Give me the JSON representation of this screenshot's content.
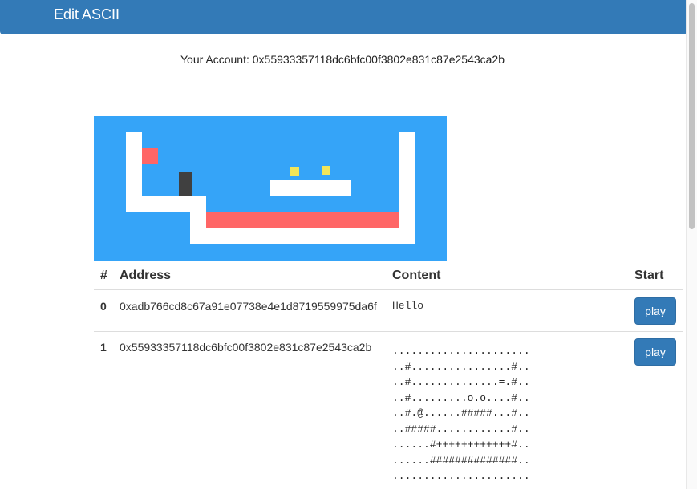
{
  "navbar": {
    "brand": "Edit ASCII"
  },
  "account": {
    "text": "Your Account: 0x55933357118dc6bfc00f3802e831c87e2543ca2b"
  },
  "table": {
    "headers": [
      "#",
      "Address",
      "Content",
      "Start"
    ],
    "rows": [
      {
        "index": "0",
        "address": "0xadb766cd8c67a91e07738e4e1d8719559975da6f",
        "content": "Hello",
        "button": "play"
      },
      {
        "index": "1",
        "address": "0x55933357118dc6bfc00f3802e831c87e2543ca2b",
        "content": "......................\n..#................#..\n..#..............=.#..\n..#.........o.o....#..\n..#.@......#####...#..\n..#####............#..\n......#++++++++++++#..\n......##############..\n......................",
        "button": "play"
      }
    ]
  },
  "colors": {
    "navbar": "#337ab7",
    "game_background": "#35a4f8",
    "wall": "#ffffff",
    "lava": "#ff6666",
    "coin": "#f1e559",
    "player": "#404040",
    "button": "#337ab7"
  }
}
